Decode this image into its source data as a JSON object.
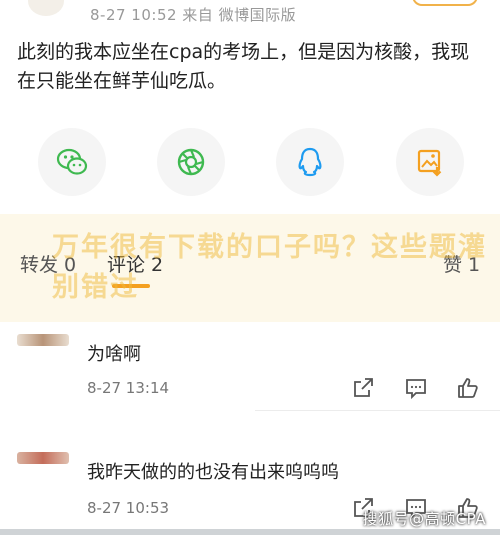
{
  "post": {
    "meta": "8-27 10:52   来自 微博国际版",
    "text": "此刻的我本应坐在cpa的考场上，但是因为核酸，我现在只能坐在鲜芋仙吃瓜。"
  },
  "share": {
    "icons": [
      "wechat-icon",
      "moments-icon",
      "qq-icon",
      "save-image-icon"
    ]
  },
  "tabs": {
    "repost": "转发 0",
    "comment": "评论 2",
    "like": "赞 1"
  },
  "overlay": {
    "text": "万年很有下载的口子吗？这些题灌别错过"
  },
  "comments": [
    {
      "text": "为啥啊",
      "time": "8-27 13:14"
    },
    {
      "text": "我昨天做的的也没有出来呜呜呜",
      "time": "8-27 10:53"
    }
  ],
  "watermark": "搜狐号@高顿CPA",
  "colors": {
    "accent": "#f4a020",
    "highlight_band": "#fdf8e9"
  }
}
